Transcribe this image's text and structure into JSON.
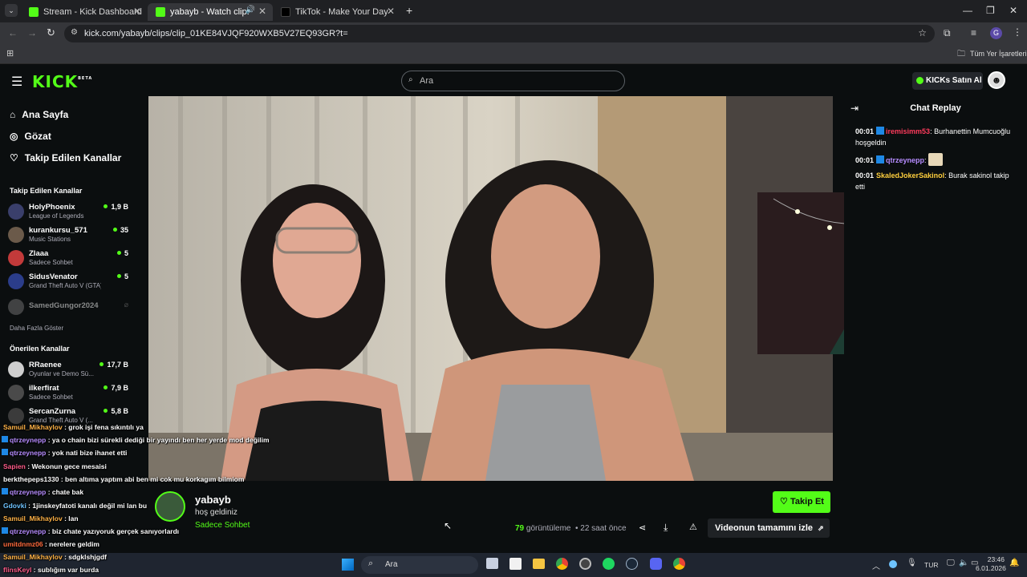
{
  "browser": {
    "tabs": [
      {
        "title": "Stream - Kick Dashboard"
      },
      {
        "title": "yabayb - Watch clips on Ki"
      },
      {
        "title": "TikTok - Make Your Day"
      }
    ],
    "url": "kick.com/yabayb/clips/clip_01KE84VJQF920WXB5V27EQ93GR?t=",
    "bookmarks_label": "Tüm Yer İşaretleri"
  },
  "header": {
    "logo": "KICK",
    "logo_sup": "BETA",
    "search_placeholder": "Ara",
    "buy_label": "KICKs Satın Al"
  },
  "sidebar": {
    "nav": [
      {
        "label": "Ana Sayfa",
        "icon": "home-icon"
      },
      {
        "label": "Gözat",
        "icon": "compass-icon"
      },
      {
        "label": "Takip Edilen Kanallar",
        "icon": "heart-icon"
      }
    ],
    "followed_title": "Takip Edilen Kanallar",
    "followed": [
      {
        "name": "HolyPhoenix",
        "game": "League of Legends",
        "viewers": "1,9 B"
      },
      {
        "name": "kurankursu_571",
        "game": "Music Stations",
        "viewers": "35"
      },
      {
        "name": "Zlaaa",
        "game": "Sadece Sohbet",
        "viewers": "5"
      },
      {
        "name": "SidusVenator",
        "game": "Grand Theft Auto V (GTA)",
        "viewers": "5"
      },
      {
        "name": "SamedGungor2024",
        "game": "",
        "viewers": ""
      }
    ],
    "show_more": "Daha Fazla Göster",
    "recommended_title": "Önerilen Kanallar",
    "recommended": [
      {
        "name": "RRaenee",
        "game": "Oyunlar ve Demo Sü...",
        "viewers": "17,7 B"
      },
      {
        "name": "ilkerfirat",
        "game": "Sadece Sohbet",
        "viewers": "7,9 B"
      },
      {
        "name": "SercanZurna",
        "game": "Grand Theft Auto V (...",
        "viewers": "5,8 B"
      }
    ]
  },
  "chat": {
    "title": "Chat Replay",
    "messages": [
      {
        "time": "00:01",
        "user": "iremisimm53",
        "user_color": "#ff3b5c",
        "text": "Burhanettin Mumcuoğlu hoşgeldin"
      },
      {
        "time": "00:01",
        "user": "qtrzeynepp",
        "user_color": "#b68cff",
        "text": ""
      },
      {
        "time": "00:01",
        "user": "SkaledJokerSakinol",
        "user_color": "#ffcf3d",
        "text": "Burak sakinol takip etti"
      }
    ]
  },
  "overlay_chat": [
    {
      "user": "Samuil_Mikhaylov",
      "color": "#ffb347",
      "text": "grok işi fena sıkıntılı ya"
    },
    {
      "user": "qtrzeynepp",
      "color": "#b68cff",
      "text": "ya o chain bizi sürekli dediği bir yayındı ben her yerde mod değilim"
    },
    {
      "user": "qtrzeynepp",
      "color": "#b68cff",
      "text": "yok nati bize ihanet etti"
    },
    {
      "user": "Sapien",
      "color": "#ff5c8a",
      "text": "Wekonun gece mesaisi"
    },
    {
      "user": "berkthepeps1330",
      "color": "#ffffff",
      "text": "ben altıma yaptım abi ben mi cok mu korkagım bilmiom"
    },
    {
      "user": "qtrzeynepp",
      "color": "#b68cff",
      "text": "chate bak"
    },
    {
      "user": "Gdovki",
      "color": "#6ec3ff",
      "text": "1jinskeyfatoti kanalı değil mi lan bu"
    },
    {
      "user": "Samuil_Mikhaylov",
      "color": "#ffb347",
      "text": "lan"
    },
    {
      "user": "qtrzeynepp",
      "color": "#b68cff",
      "text": "biz chate yazıyoruk gerçek sanıyorlardı"
    },
    {
      "user": "umitdnmz06",
      "color": "#ff6b3d",
      "text": "nerelere geldim"
    },
    {
      "user": "Samuil_Mikhaylov",
      "color": "#ffb347",
      "text": "sdgklshjgdf"
    },
    {
      "user": "flinsKeyl",
      "color": "#ff5c8a",
      "text": "sublığım var burda"
    }
  ],
  "clip": {
    "channel": "yabayb",
    "title": "hoş geldiniz",
    "category": "Sadece Sohbet",
    "views_count": "79",
    "views_label": "görüntüleme",
    "age": "22 saat önce",
    "follow_label": "Takip Et",
    "watch_full_label": "Videonun tamamını izle"
  },
  "taskbar": {
    "search": "Ara",
    "lang": "TUR",
    "time": "23:46",
    "date": "6.01.2026"
  },
  "colors": {
    "kick_green": "#53fc18",
    "background": "#0b0e0f"
  }
}
